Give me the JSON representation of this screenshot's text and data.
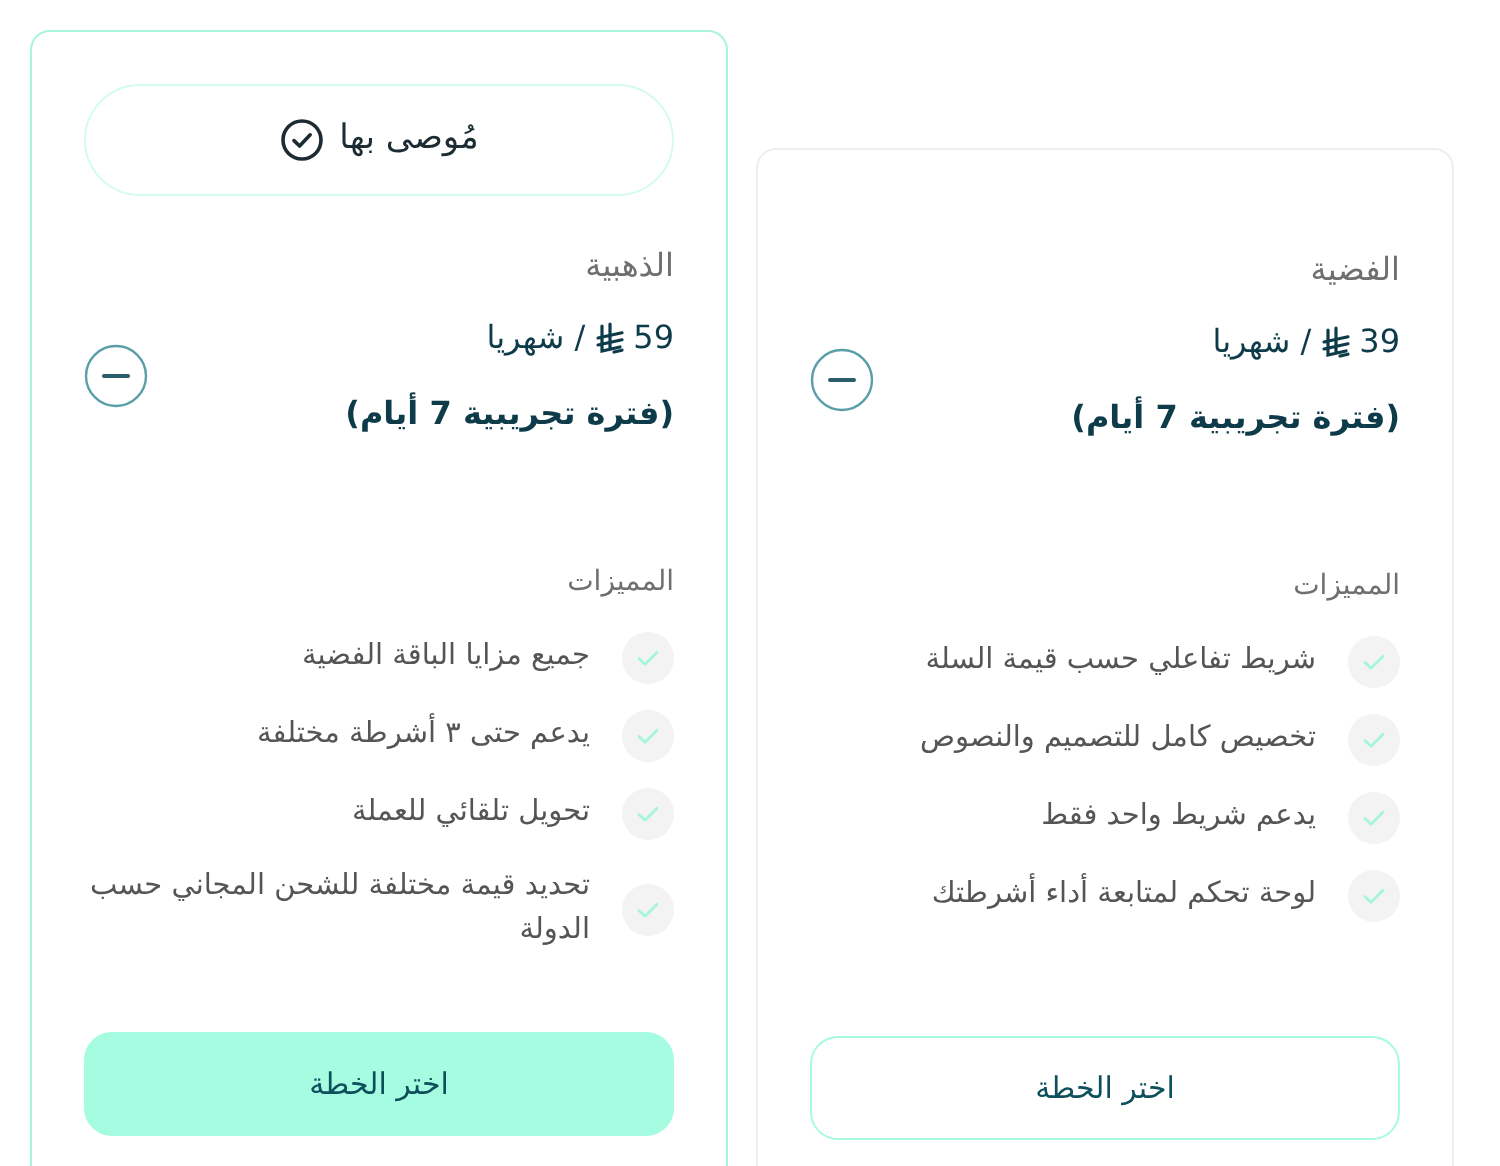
{
  "plans": [
    {
      "name": "الفضية",
      "recommended": false,
      "amount": "39",
      "period": "/ شهريا",
      "trial": "(فترة تجريبية 7 أيام)",
      "features_title": "المميزات",
      "features": [
        "شريط تفاعلي حسب قيمة السلة",
        "تخصيص كامل للتصميم والنصوص",
        "يدعم شريط واحد فقط",
        "لوحة تحكم لمتابعة أداء أشرطتك"
      ],
      "button": "اختر الخطة"
    },
    {
      "name": "الذهبية",
      "recommended": true,
      "badge": "مُوصى بها",
      "amount": "59",
      "period": "/ شهريا",
      "trial": "(فترة تجريبية 7 أيام)",
      "features_title": "المميزات",
      "features": [
        "جميع مزايا الباقة الفضية",
        "يدعم حتى ٣ أشرطة مختلفة",
        "تحويل تلقائي للعملة",
        "تحديد قيمة مختلفة للشحن المجاني حسب الدولة"
      ],
      "button": "اختر الخطة"
    }
  ]
}
